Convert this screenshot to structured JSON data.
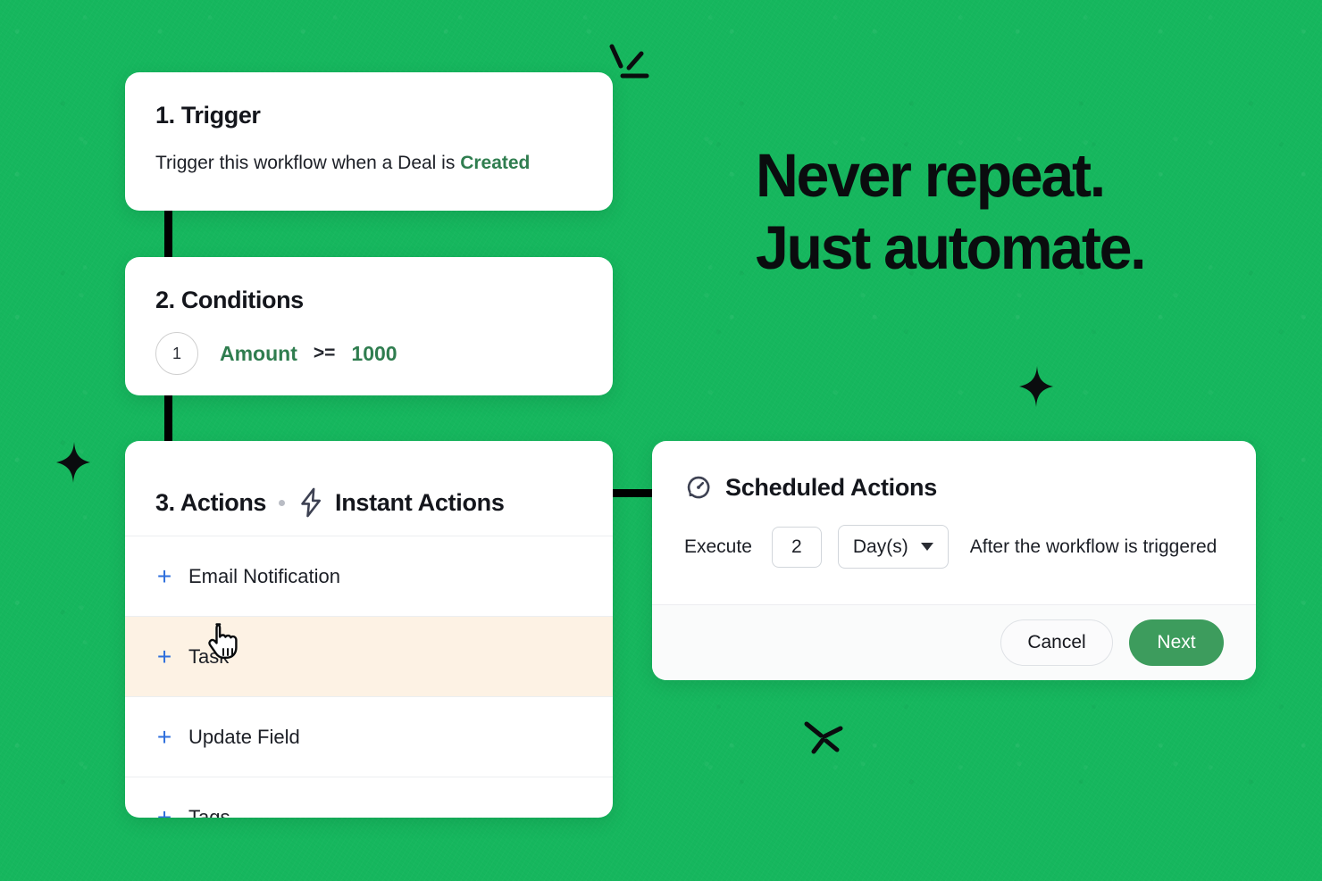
{
  "theme": {
    "background_green": "#16b75e",
    "accent_green": "#2f7d4f",
    "button_green": "#3d9c5d",
    "plus_blue": "#2f6fdc",
    "highlight_peach": "#fdf2e4",
    "icon_slate": "#3d4152"
  },
  "headline": {
    "line1": "Never repeat.",
    "line2": "Just automate."
  },
  "trigger_card": {
    "title": "1. Trigger",
    "description_prefix": "Trigger this workflow when a Deal is ",
    "description_accent": "Created"
  },
  "conditions_card": {
    "title": "2. Conditions",
    "rows": [
      {
        "index": "1",
        "field": "Amount",
        "operator": ">=",
        "value": "1000"
      }
    ]
  },
  "actions_card": {
    "title": "3. Actions",
    "tab_label": "Instant Actions",
    "bolt_icon": "lightning-bolt-icon",
    "items": [
      {
        "label": "Email Notification",
        "icon": "plus-icon",
        "highlighted": false
      },
      {
        "label": "Task",
        "icon": "plus-icon",
        "highlighted": true
      },
      {
        "label": "Update Field",
        "icon": "plus-icon",
        "highlighted": false
      },
      {
        "label": "Tags",
        "icon": "plus-icon",
        "highlighted": false
      }
    ]
  },
  "scheduled_panel": {
    "title": "Scheduled Actions",
    "clock_icon": "scheduled-clock-icon",
    "execute_label": "Execute",
    "amount_value": "2",
    "unit_selected": "Day(s)",
    "unit_options": [
      "Day(s)"
    ],
    "suffix_label": "After the workflow is triggered",
    "cancel_label": "Cancel",
    "next_label": "Next"
  },
  "cursor": {
    "type": "pointing-hand-cursor"
  },
  "decorations": [
    {
      "name": "pop-lines-mark"
    },
    {
      "name": "sparkle-star-left"
    },
    {
      "name": "sparkle-star-right"
    },
    {
      "name": "asterisk-mark"
    }
  ]
}
